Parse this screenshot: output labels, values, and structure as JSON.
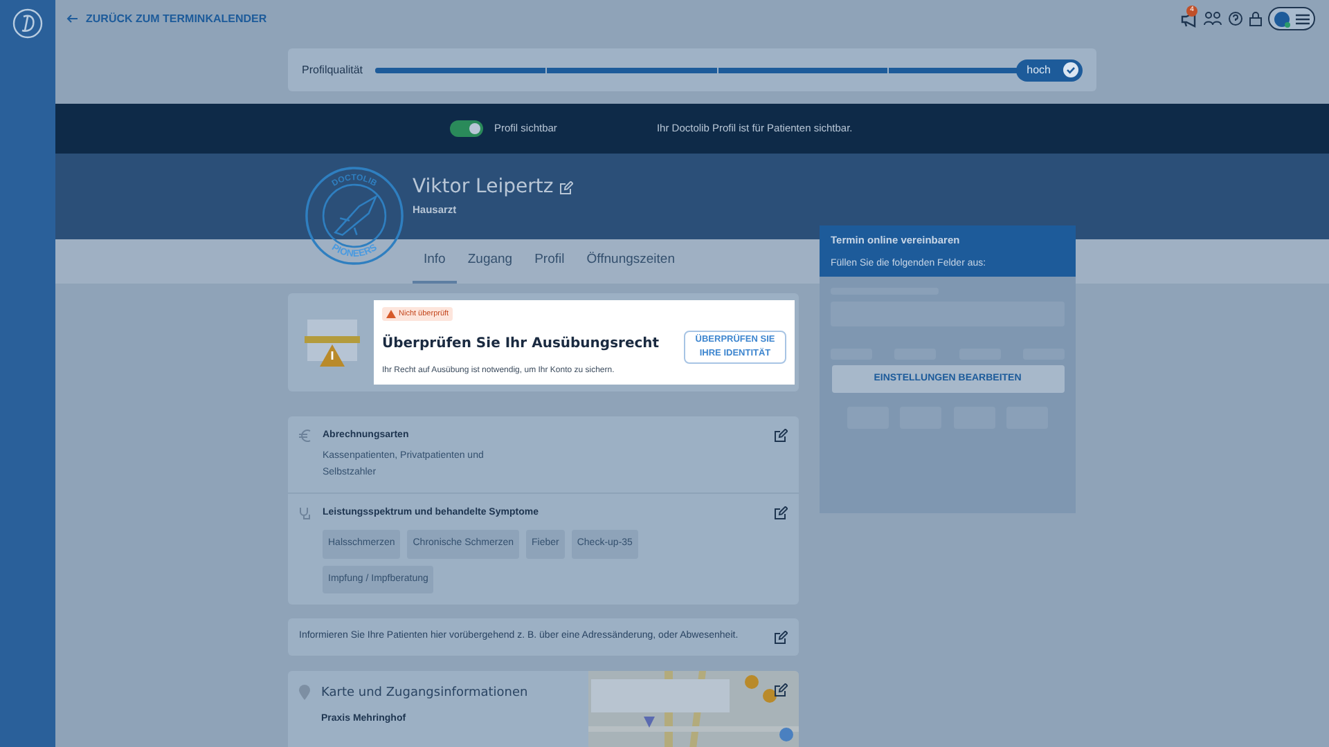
{
  "top_bar": {
    "back_link": "ZURÜCK ZUM TERMINKALENDER",
    "notification_count": "4"
  },
  "profile_quality": {
    "label": "Profilqualität",
    "level": 1,
    "badge": "hoch"
  },
  "visibility": {
    "toggle_label": "Profil sichtbar",
    "on": true,
    "message": "Ihr Doctolib Profil ist für Patienten sichtbar."
  },
  "profile": {
    "logo_top": "DOCTOLIB",
    "logo_bottom": "PIONEERS",
    "name": "Viktor Leipertz",
    "specialty": "Hausarzt"
  },
  "tabs": [
    {
      "label": "Info",
      "selected": true
    },
    {
      "label": "Zugang",
      "selected": false
    },
    {
      "label": "Profil",
      "selected": false
    },
    {
      "label": "Öffnungszeiten",
      "selected": false
    }
  ],
  "verification": {
    "status": "Nicht überprüft",
    "title": "Überprüfen Sie Ihr Ausübungsrecht",
    "text": "Ihr Recht auf Ausübung ist notwendig, um Ihr Konto zu sichern.",
    "button": "ÜBERPRÜFEN SIE IHRE IDENTITÄT"
  },
  "sections": [
    {
      "kind": "text",
      "title": "Abrechnungsarten",
      "text": "Kassenpatienten, Privatpatienten und Selbstzahler"
    },
    {
      "kind": "tags",
      "title": "Leistungsspektrum und behandelte Symptome",
      "tags": [
        "Halsschmerzen",
        "Chronische Schmerzen",
        "Fieber",
        "Check-up-35",
        "Impfung / Impfberatung"
      ]
    }
  ],
  "notice": "Informieren Sie Ihre Patienten hier vorübergehend z. B. über eine Adressänderung, oder Abwesenheit.",
  "location": {
    "title": "Karte und Zugangsinformationen",
    "practice": "Praxis Mehringhof"
  },
  "booking": {
    "title": "Termin online vereinbaren",
    "subtitle": "Füllen Sie die folgenden Felder aus:",
    "button": "EINSTELLUNGEN BEARBEITEN"
  }
}
